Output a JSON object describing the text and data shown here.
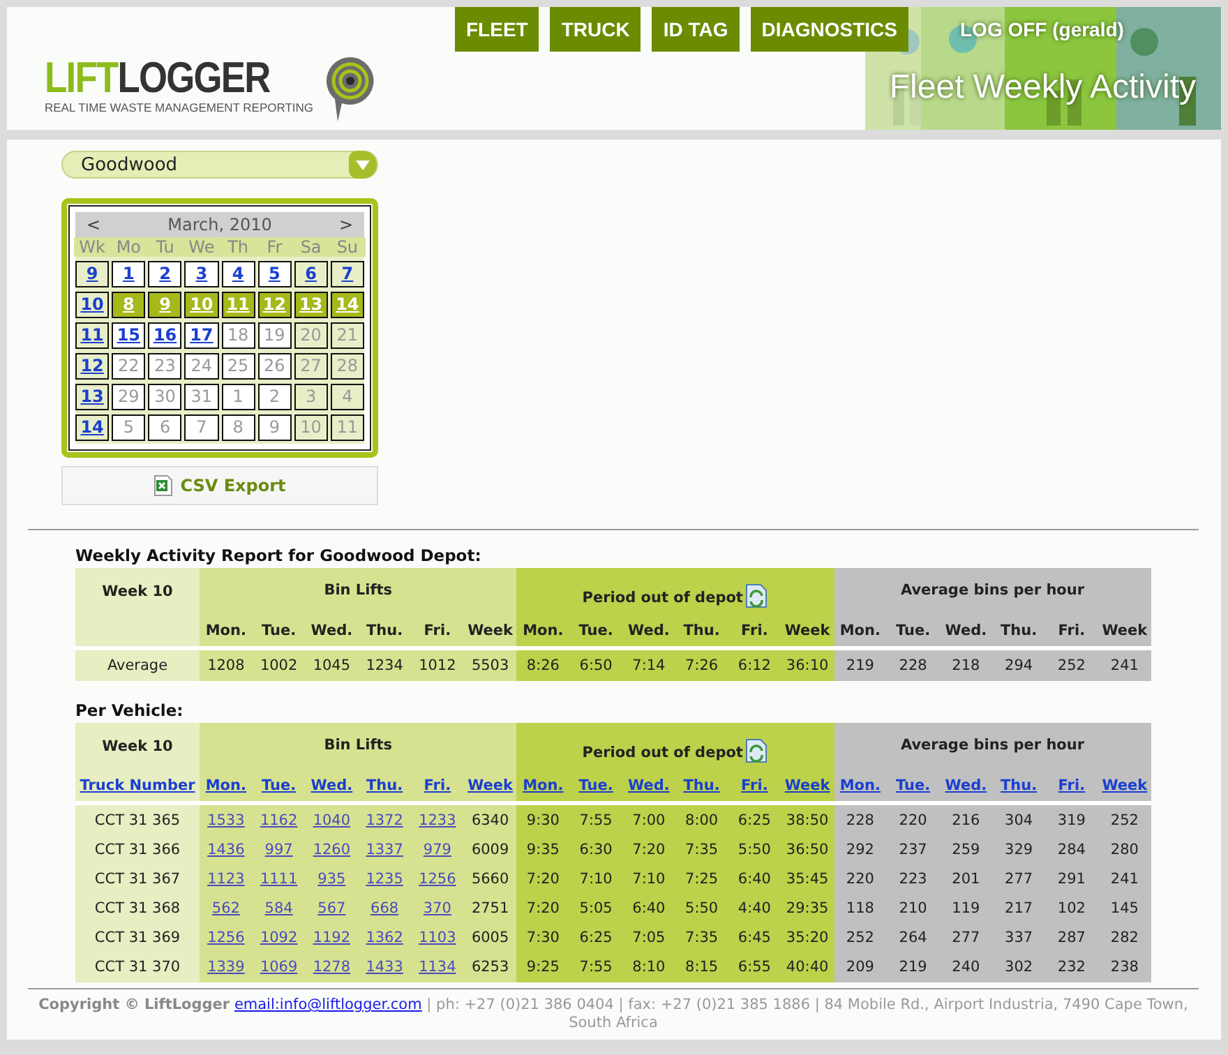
{
  "nav": [
    {
      "label": "FLEET"
    },
    {
      "label": "TRUCK"
    },
    {
      "label": "ID TAG"
    },
    {
      "label": "DIAGNOSTICS"
    }
  ],
  "logoff": "LOG OFF (gerald)",
  "page_title": "Fleet Weekly Activity",
  "logo": {
    "part1": "LIFT",
    "part2": "LOGGER",
    "tagline": "REAL TIME WASTE MANAGEMENT REPORTING"
  },
  "depot_select": {
    "value": "Goodwood"
  },
  "calendar": {
    "prev": "<",
    "month": "March, 2010",
    "next": ">",
    "headers": [
      "Wk",
      "Mo",
      "Tu",
      "We",
      "Th",
      "Fr",
      "Sa",
      "Su"
    ],
    "weeks": [
      {
        "week": "9",
        "days": [
          {
            "label": "1",
            "link": true,
            "selected": false
          },
          {
            "label": "2",
            "link": true,
            "selected": false
          },
          {
            "label": "3",
            "link": true,
            "selected": false
          },
          {
            "label": "4",
            "link": true,
            "selected": false
          },
          {
            "label": "5",
            "link": true,
            "selected": false
          },
          {
            "label": "6",
            "link": true,
            "selected": false
          },
          {
            "label": "7",
            "link": true,
            "selected": false
          }
        ]
      },
      {
        "week": "10",
        "days": [
          {
            "label": "8",
            "link": true,
            "selected": true
          },
          {
            "label": "9",
            "link": true,
            "selected": true
          },
          {
            "label": "10",
            "link": true,
            "selected": true
          },
          {
            "label": "11",
            "link": true,
            "selected": true
          },
          {
            "label": "12",
            "link": true,
            "selected": true
          },
          {
            "label": "13",
            "link": true,
            "selected": true
          },
          {
            "label": "14",
            "link": true,
            "selected": true
          }
        ]
      },
      {
        "week": "11",
        "days": [
          {
            "label": "15",
            "link": true,
            "selected": false
          },
          {
            "label": "16",
            "link": true,
            "selected": false
          },
          {
            "label": "17",
            "link": true,
            "selected": false
          },
          {
            "label": "18",
            "link": false,
            "selected": false
          },
          {
            "label": "19",
            "link": false,
            "selected": false
          },
          {
            "label": "20",
            "link": false,
            "selected": false
          },
          {
            "label": "21",
            "link": false,
            "selected": false
          }
        ]
      },
      {
        "week": "12",
        "days": [
          {
            "label": "22",
            "link": false,
            "selected": false
          },
          {
            "label": "23",
            "link": false,
            "selected": false
          },
          {
            "label": "24",
            "link": false,
            "selected": false
          },
          {
            "label": "25",
            "link": false,
            "selected": false
          },
          {
            "label": "26",
            "link": false,
            "selected": false
          },
          {
            "label": "27",
            "link": false,
            "selected": false
          },
          {
            "label": "28",
            "link": false,
            "selected": false
          }
        ]
      },
      {
        "week": "13",
        "days": [
          {
            "label": "29",
            "link": false,
            "selected": false
          },
          {
            "label": "30",
            "link": false,
            "selected": false
          },
          {
            "label": "31",
            "link": false,
            "selected": false
          },
          {
            "label": "1",
            "link": false,
            "selected": false
          },
          {
            "label": "2",
            "link": false,
            "selected": false
          },
          {
            "label": "3",
            "link": false,
            "selected": false
          },
          {
            "label": "4",
            "link": false,
            "selected": false
          }
        ]
      },
      {
        "week": "14",
        "days": [
          {
            "label": "5",
            "link": false,
            "selected": false
          },
          {
            "label": "6",
            "link": false,
            "selected": false
          },
          {
            "label": "7",
            "link": false,
            "selected": false
          },
          {
            "label": "8",
            "link": false,
            "selected": false
          },
          {
            "label": "9",
            "link": false,
            "selected": false
          },
          {
            "label": "10",
            "link": false,
            "selected": false
          },
          {
            "label": "11",
            "link": false,
            "selected": false
          }
        ]
      }
    ]
  },
  "csv_export": "CSV Export",
  "tables": [
    {
      "title": "Weekly Activity Report for Goodwood Depot:",
      "corner": "Week 10",
      "groups": [
        {
          "title": "Bin Lifts",
          "kind": "lifts",
          "columns": [
            {
              "label": "Mon.",
              "link": false,
              "cell_links": false
            },
            {
              "label": "Tue.",
              "link": false,
              "cell_links": false
            },
            {
              "label": "Wed.",
              "link": false,
              "cell_links": false
            },
            {
              "label": "Thu.",
              "link": false,
              "cell_links": false
            },
            {
              "label": "Fri.",
              "link": false,
              "cell_links": false
            },
            {
              "label": "Week",
              "link": false,
              "cell_links": false
            }
          ]
        },
        {
          "title": "Period out of depot",
          "kind": "period",
          "columns": [
            {
              "label": "Mon.",
              "link": false,
              "cell_links": false
            },
            {
              "label": "Tue.",
              "link": false,
              "cell_links": false
            },
            {
              "label": "Wed.",
              "link": false,
              "cell_links": false
            },
            {
              "label": "Thu.",
              "link": false,
              "cell_links": false
            },
            {
              "label": "Fri.",
              "link": false,
              "cell_links": false
            },
            {
              "label": "Week",
              "link": false,
              "cell_links": false
            }
          ]
        },
        {
          "title": "Average bins per hour",
          "kind": "rate",
          "columns": [
            {
              "label": "Mon.",
              "link": false,
              "cell_links": false
            },
            {
              "label": "Tue.",
              "link": false,
              "cell_links": false
            },
            {
              "label": "Wed.",
              "link": false,
              "cell_links": false
            },
            {
              "label": "Thu.",
              "link": false,
              "cell_links": false
            },
            {
              "label": "Fri.",
              "link": false,
              "cell_links": false
            },
            {
              "label": "Week",
              "link": false,
              "cell_links": false
            }
          ]
        }
      ],
      "rows": [
        {
          "label": "Average",
          "values": [
            "1208",
            "1002",
            "1045",
            "1234",
            "1012",
            "5503",
            "8:26",
            "6:50",
            "7:14",
            "7:26",
            "6:12",
            "36:10",
            "219",
            "228",
            "218",
            "294",
            "252",
            "241"
          ]
        }
      ]
    },
    {
      "title": "Per Vehicle:",
      "corner": "Week 10",
      "row_header": "Truck Number",
      "groups": [
        {
          "title": "Bin Lifts",
          "kind": "lifts",
          "columns": [
            {
              "label": "Mon.",
              "link": true,
              "cell_links": true
            },
            {
              "label": "Tue.",
              "link": true,
              "cell_links": true
            },
            {
              "label": "Wed.",
              "link": true,
              "cell_links": true
            },
            {
              "label": "Thu.",
              "link": true,
              "cell_links": true
            },
            {
              "label": "Fri.",
              "link": true,
              "cell_links": true
            },
            {
              "label": "Week",
              "link": true,
              "cell_links": false
            }
          ]
        },
        {
          "title": "Period out of depot",
          "kind": "period",
          "columns": [
            {
              "label": "Mon.",
              "link": true,
              "cell_links": false
            },
            {
              "label": "Tue.",
              "link": true,
              "cell_links": false
            },
            {
              "label": "Wed.",
              "link": true,
              "cell_links": false
            },
            {
              "label": "Thu.",
              "link": true,
              "cell_links": false
            },
            {
              "label": "Fri.",
              "link": true,
              "cell_links": false
            },
            {
              "label": "Week",
              "link": true,
              "cell_links": false
            }
          ]
        },
        {
          "title": "Average bins per hour",
          "kind": "rate",
          "columns": [
            {
              "label": "Mon.",
              "link": true,
              "cell_links": false
            },
            {
              "label": "Tue.",
              "link": true,
              "cell_links": false
            },
            {
              "label": "Wed.",
              "link": true,
              "cell_links": false
            },
            {
              "label": "Thu.",
              "link": true,
              "cell_links": false
            },
            {
              "label": "Fri.",
              "link": true,
              "cell_links": false
            },
            {
              "label": "Week",
              "link": true,
              "cell_links": false
            }
          ]
        }
      ],
      "rows": [
        {
          "label": "CCT 31 365",
          "values": [
            "1533",
            "1162",
            "1040",
            "1372",
            "1233",
            "6340",
            "9:30",
            "7:55",
            "7:00",
            "8:00",
            "6:25",
            "38:50",
            "228",
            "220",
            "216",
            "304",
            "319",
            "252"
          ]
        },
        {
          "label": "CCT 31 366",
          "values": [
            "1436",
            "997",
            "1260",
            "1337",
            "979",
            "6009",
            "9:35",
            "6:30",
            "7:20",
            "7:35",
            "5:50",
            "36:50",
            "292",
            "237",
            "259",
            "329",
            "284",
            "280"
          ]
        },
        {
          "label": "CCT 31 367",
          "values": [
            "1123",
            "1111",
            "935",
            "1235",
            "1256",
            "5660",
            "7:20",
            "7:10",
            "7:10",
            "7:25",
            "6:40",
            "35:45",
            "220",
            "223",
            "201",
            "277",
            "291",
            "241"
          ]
        },
        {
          "label": "CCT 31 368",
          "values": [
            "562",
            "584",
            "567",
            "668",
            "370",
            "2751",
            "7:20",
            "5:05",
            "6:40",
            "5:50",
            "4:40",
            "29:35",
            "118",
            "210",
            "119",
            "217",
            "102",
            "145"
          ]
        },
        {
          "label": "CCT 31 369",
          "values": [
            "1256",
            "1092",
            "1192",
            "1362",
            "1103",
            "6005",
            "7:30",
            "6:25",
            "7:05",
            "7:35",
            "6:45",
            "35:20",
            "252",
            "264",
            "277",
            "337",
            "287",
            "282"
          ]
        },
        {
          "label": "CCT 31 370",
          "values": [
            "1339",
            "1069",
            "1278",
            "1433",
            "1134",
            "6253",
            "9:25",
            "7:55",
            "8:10",
            "8:15",
            "6:55",
            "40:40",
            "209",
            "219",
            "240",
            "302",
            "232",
            "238"
          ]
        }
      ]
    }
  ],
  "footer": {
    "copyright": "Copyright © LiftLogger",
    "email": "email:info@liftlogger.com",
    "details": "| ph: +27 (0)21 386 0404 | fax: +27 (0)21 385 1886 | 84 Mobile Rd., Airport Industria, 7490 Cape Town, South Africa"
  }
}
